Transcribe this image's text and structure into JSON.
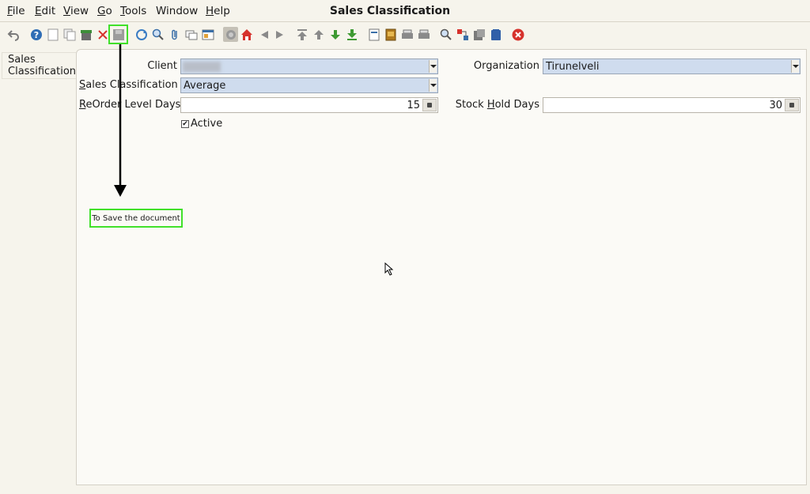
{
  "menu": {
    "file": {
      "ul": "F",
      "rest": "ile"
    },
    "edit": {
      "ul": "E",
      "rest": "dit"
    },
    "view": {
      "ul": "V",
      "rest": "iew"
    },
    "go": {
      "ul": "G",
      "rest": "o"
    },
    "tools": {
      "ul": "T",
      "rest": "ools"
    },
    "window": "Window",
    "help": {
      "ul": "H",
      "rest": "elp"
    }
  },
  "window_title": "Sales Classification",
  "side_tab": {
    "line1": "Sales",
    "line2": "Classification"
  },
  "form": {
    "client_label": "Client",
    "client_value": "",
    "organization_label": "Organization",
    "organization_value": "Tirunelveli",
    "sales_class_label": {
      "pre": "",
      "ul": "S",
      "rest": "ales Classification"
    },
    "sales_class_value": "Average",
    "reorder_label": {
      "ul": "R",
      "rest": "eOrder Level Days"
    },
    "reorder_value": "15",
    "stock_hold_label": {
      "pre": "Stock ",
      "ul": "H",
      "rest": "old Days"
    },
    "stock_hold_value": "30",
    "active_label": "Active",
    "active_checked": true
  },
  "annotation": {
    "text": "To Save the document"
  },
  "colors": {
    "highlight": "#41e02a",
    "combo_bg": "#cfdcee",
    "accent_red": "#d6322c"
  }
}
